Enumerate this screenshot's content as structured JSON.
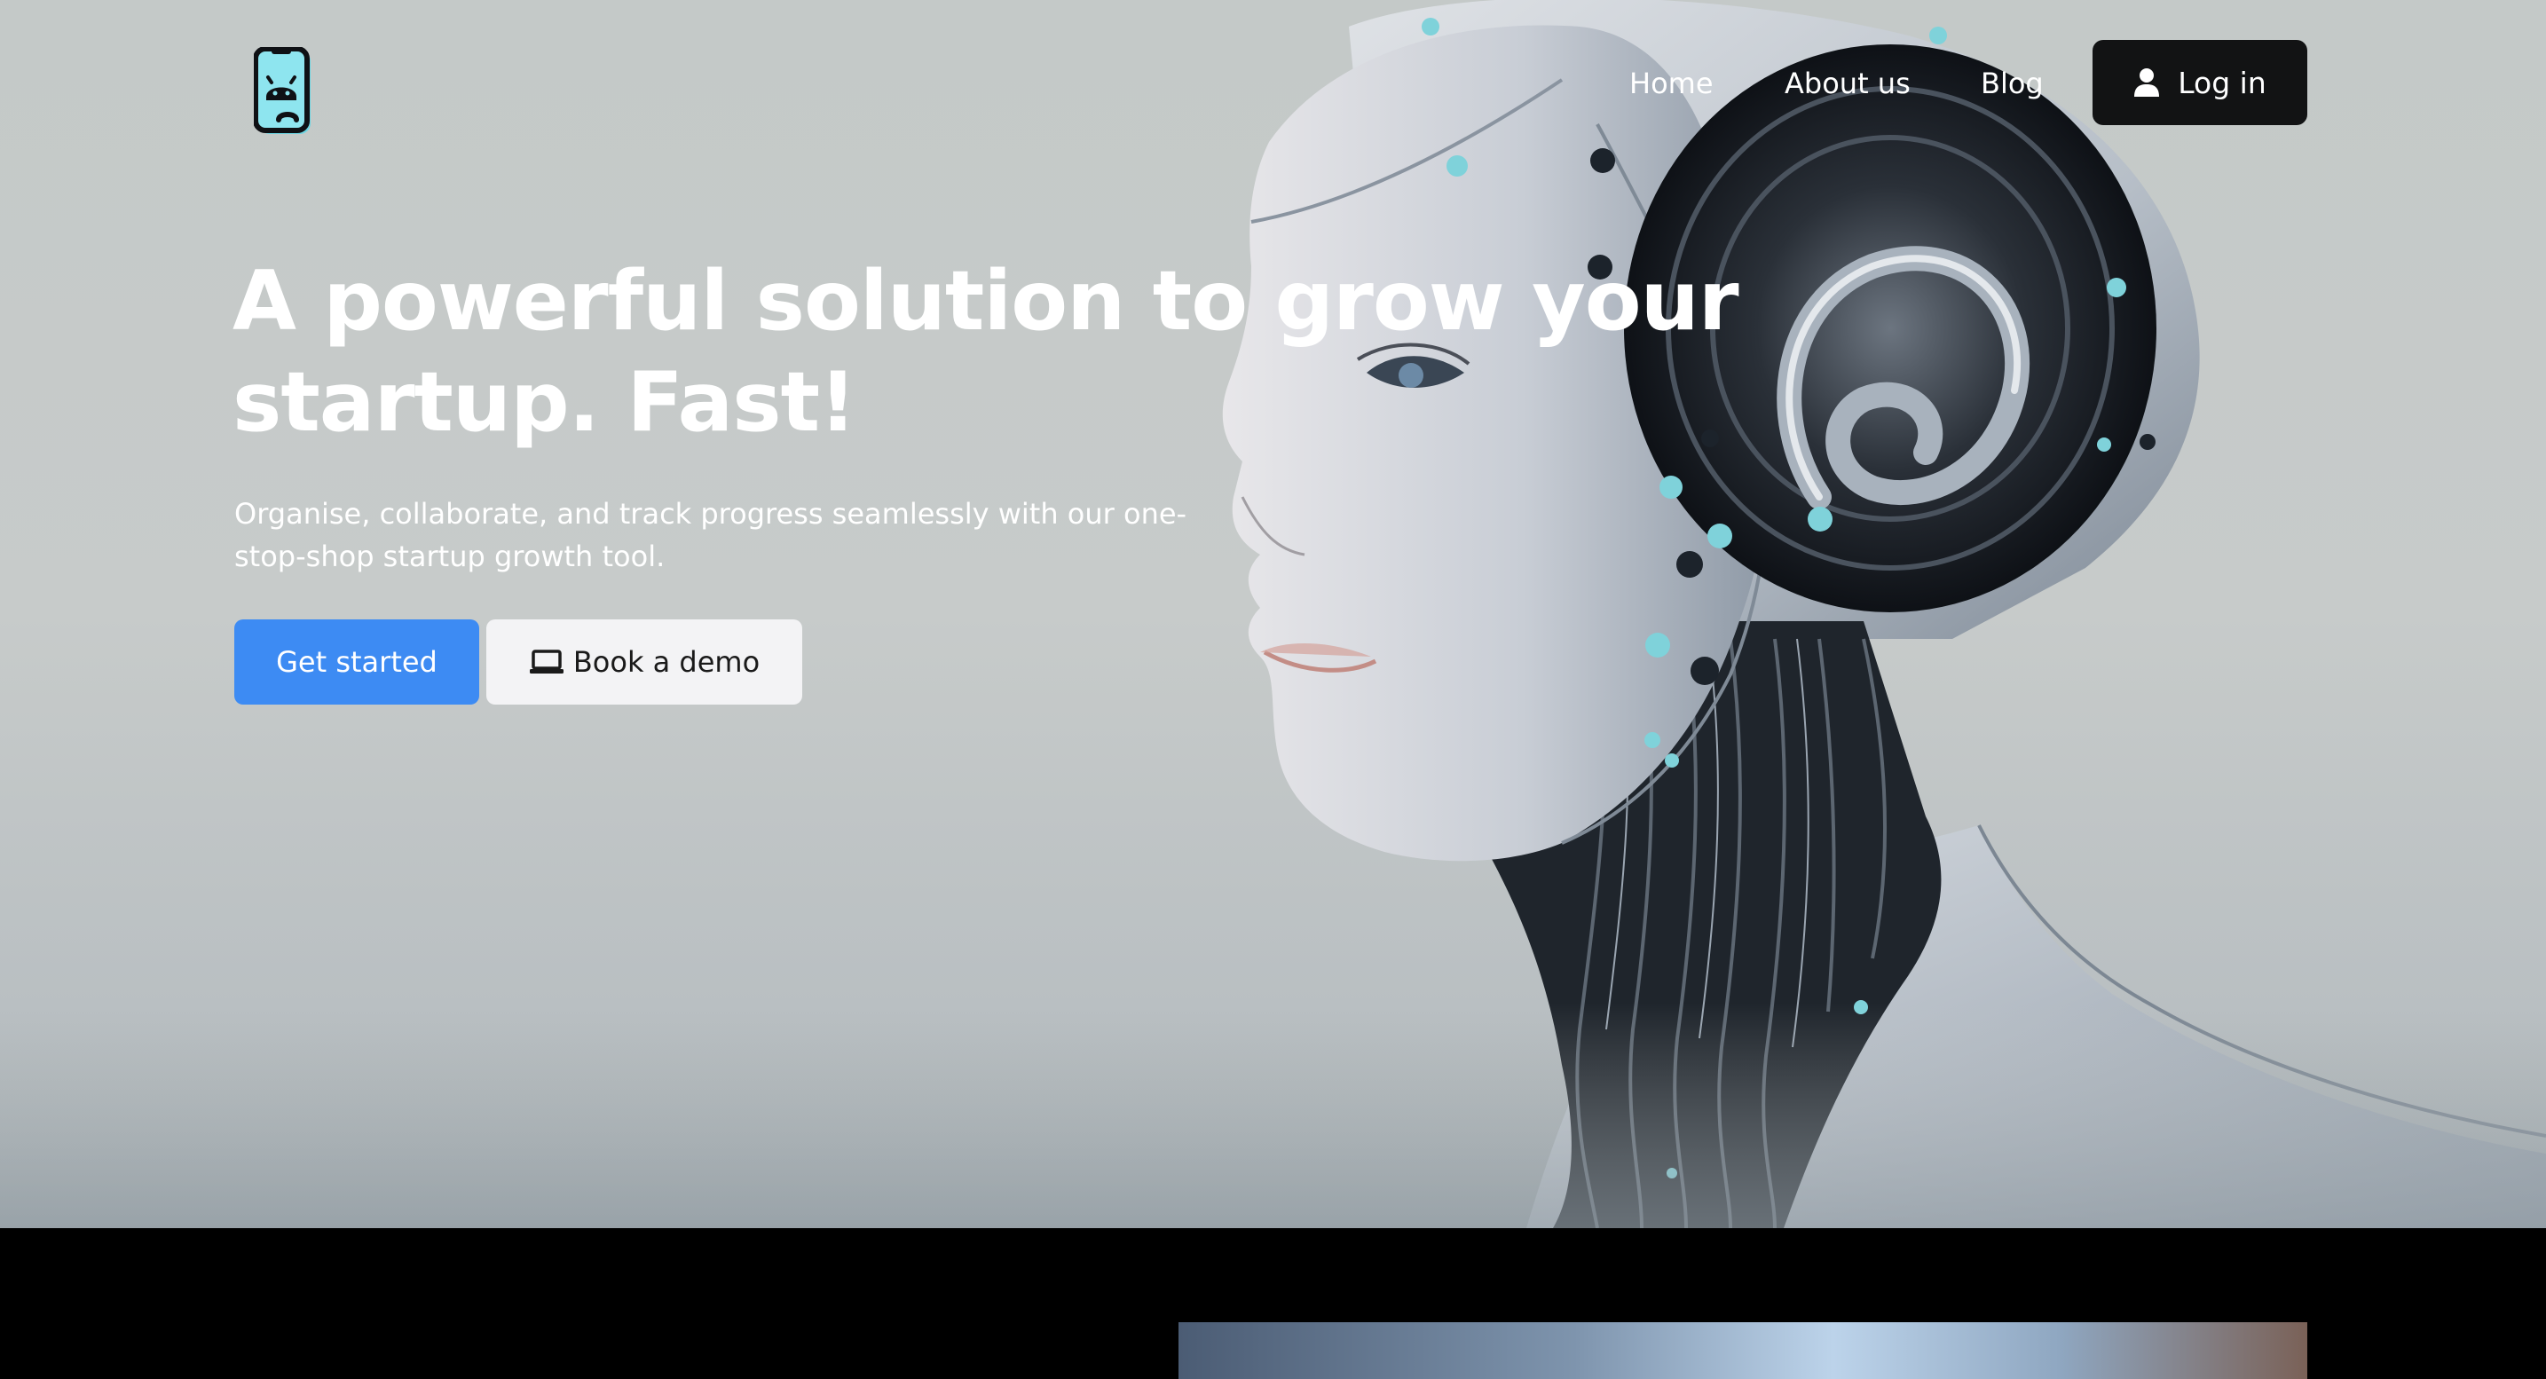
{
  "brand": {
    "logo_icon": "robot-phone-icon",
    "accent_color": "#5ed8e8"
  },
  "nav": {
    "items": [
      {
        "label": "Home"
      },
      {
        "label": "About us"
      },
      {
        "label": "Blog"
      }
    ],
    "login": {
      "label": "Log in",
      "icon": "user-icon"
    }
  },
  "hero": {
    "title": "A powerful solution to grow your startup. Fast!",
    "subtitle": "Organise, collaborate, and track progress seamlessly with our one-stop-shop startup growth tool.",
    "primary_cta": {
      "label": "Get started",
      "color": "#3d8bf3"
    },
    "secondary_cta": {
      "label": "Book a demo",
      "icon": "laptop-icon"
    },
    "image_subject": "humanoid-robot-portrait"
  },
  "colors": {
    "hero_background": "#c5c9c8",
    "login_background": "#121314",
    "dark_section": "#000000"
  }
}
